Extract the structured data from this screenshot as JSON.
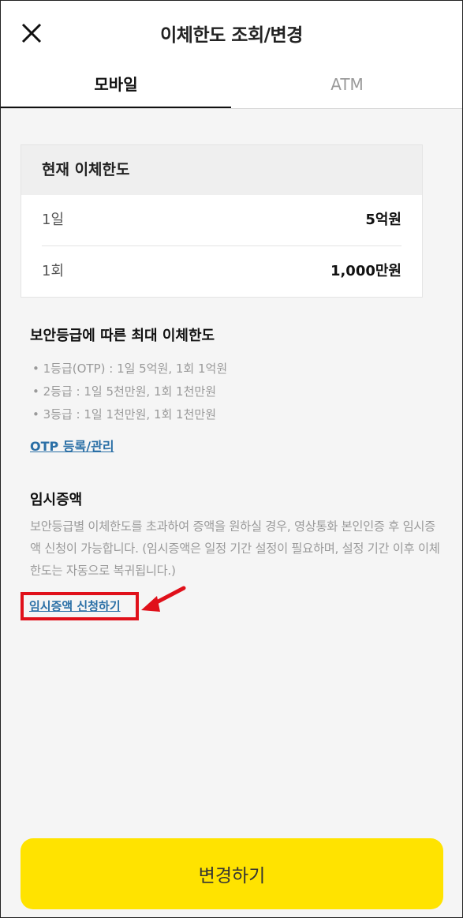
{
  "header": {
    "title": "이체한도 조회/변경",
    "close_icon": "close-icon"
  },
  "tabs": [
    {
      "label": "모바일",
      "active": true
    },
    {
      "label": "ATM",
      "active": false
    }
  ],
  "current_limit": {
    "heading": "현재 이체한도",
    "rows": [
      {
        "label": "1일",
        "value": "5억원"
      },
      {
        "label": "1회",
        "value": "1,000만원"
      }
    ]
  },
  "security_grade": {
    "heading": "보안등급에 따른 최대 이체한도",
    "items": [
      "• 1등급(OTP) : 1일 5억원, 1회 1억원",
      "• 2등급 : 1일 5천만원, 1회 1천만원",
      "• 3등급 : 1일 1천만원, 1회 1천만원"
    ],
    "otp_link": "OTP 등록/관리"
  },
  "temporary_increase": {
    "heading": "임시증액",
    "description": "보안등급별 이체한도를 초과하여 증액을 원하실 경우, 영상통화 본인인증 후 임시증액 신청이 가능합니다. (임시증액은 일정 기간 설정이 필요하며, 설정 기간 이후 이체한도는 자동으로 복귀됩니다.)",
    "apply_link": "임시증액 신청하기"
  },
  "submit": {
    "label": "변경하기"
  },
  "colors": {
    "accent_yellow": "#ffe300",
    "link_blue": "#2a6fa6",
    "highlight_red": "#e0101a"
  }
}
